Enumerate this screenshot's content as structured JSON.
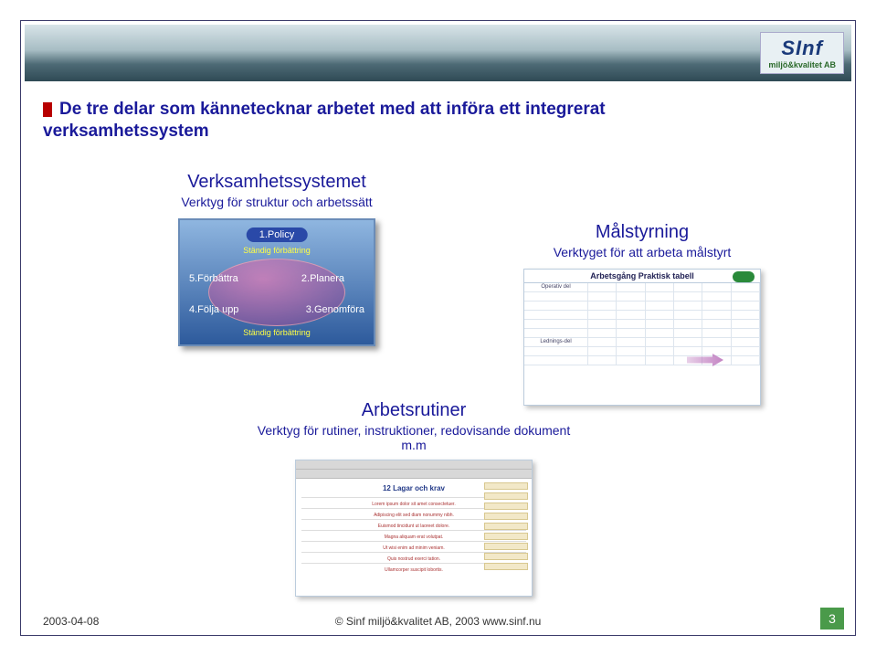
{
  "logo": {
    "name": "SInf",
    "tagline": "miljö&kvalitet AB"
  },
  "slide_title": "De tre delar som kännetecknar arbetet med att införa ett integrerat verksamhetssystem",
  "section1": {
    "heading": "Verksamhetssystemet",
    "sub": "Verktyg för struktur och arbetssätt",
    "pill": "1.Policy",
    "improve_label": "Ständig förbättring",
    "steps": {
      "s5": "5.Förbättra",
      "s2": "2.Planera",
      "s4": "4.Följa upp",
      "s3": "3.Genomföra"
    }
  },
  "section2": {
    "heading": "Målstyrning",
    "sub": "Verktyget för att arbeta målstyrt",
    "table_title": "Arbetsgång Praktisk tabell",
    "row_a": "Operativ del",
    "row_b": "Lednings-del"
  },
  "section3": {
    "heading": "Arbetsrutiner",
    "sub": "Verktyg för rutiner, instruktioner, redovisande dokument m.m",
    "doc_heading": "12 Lagar och krav"
  },
  "footer": {
    "date": "2003-04-08",
    "copyright": "© Sinf miljö&kvalitet AB, 2003 www.sinf.nu",
    "page": "3"
  }
}
